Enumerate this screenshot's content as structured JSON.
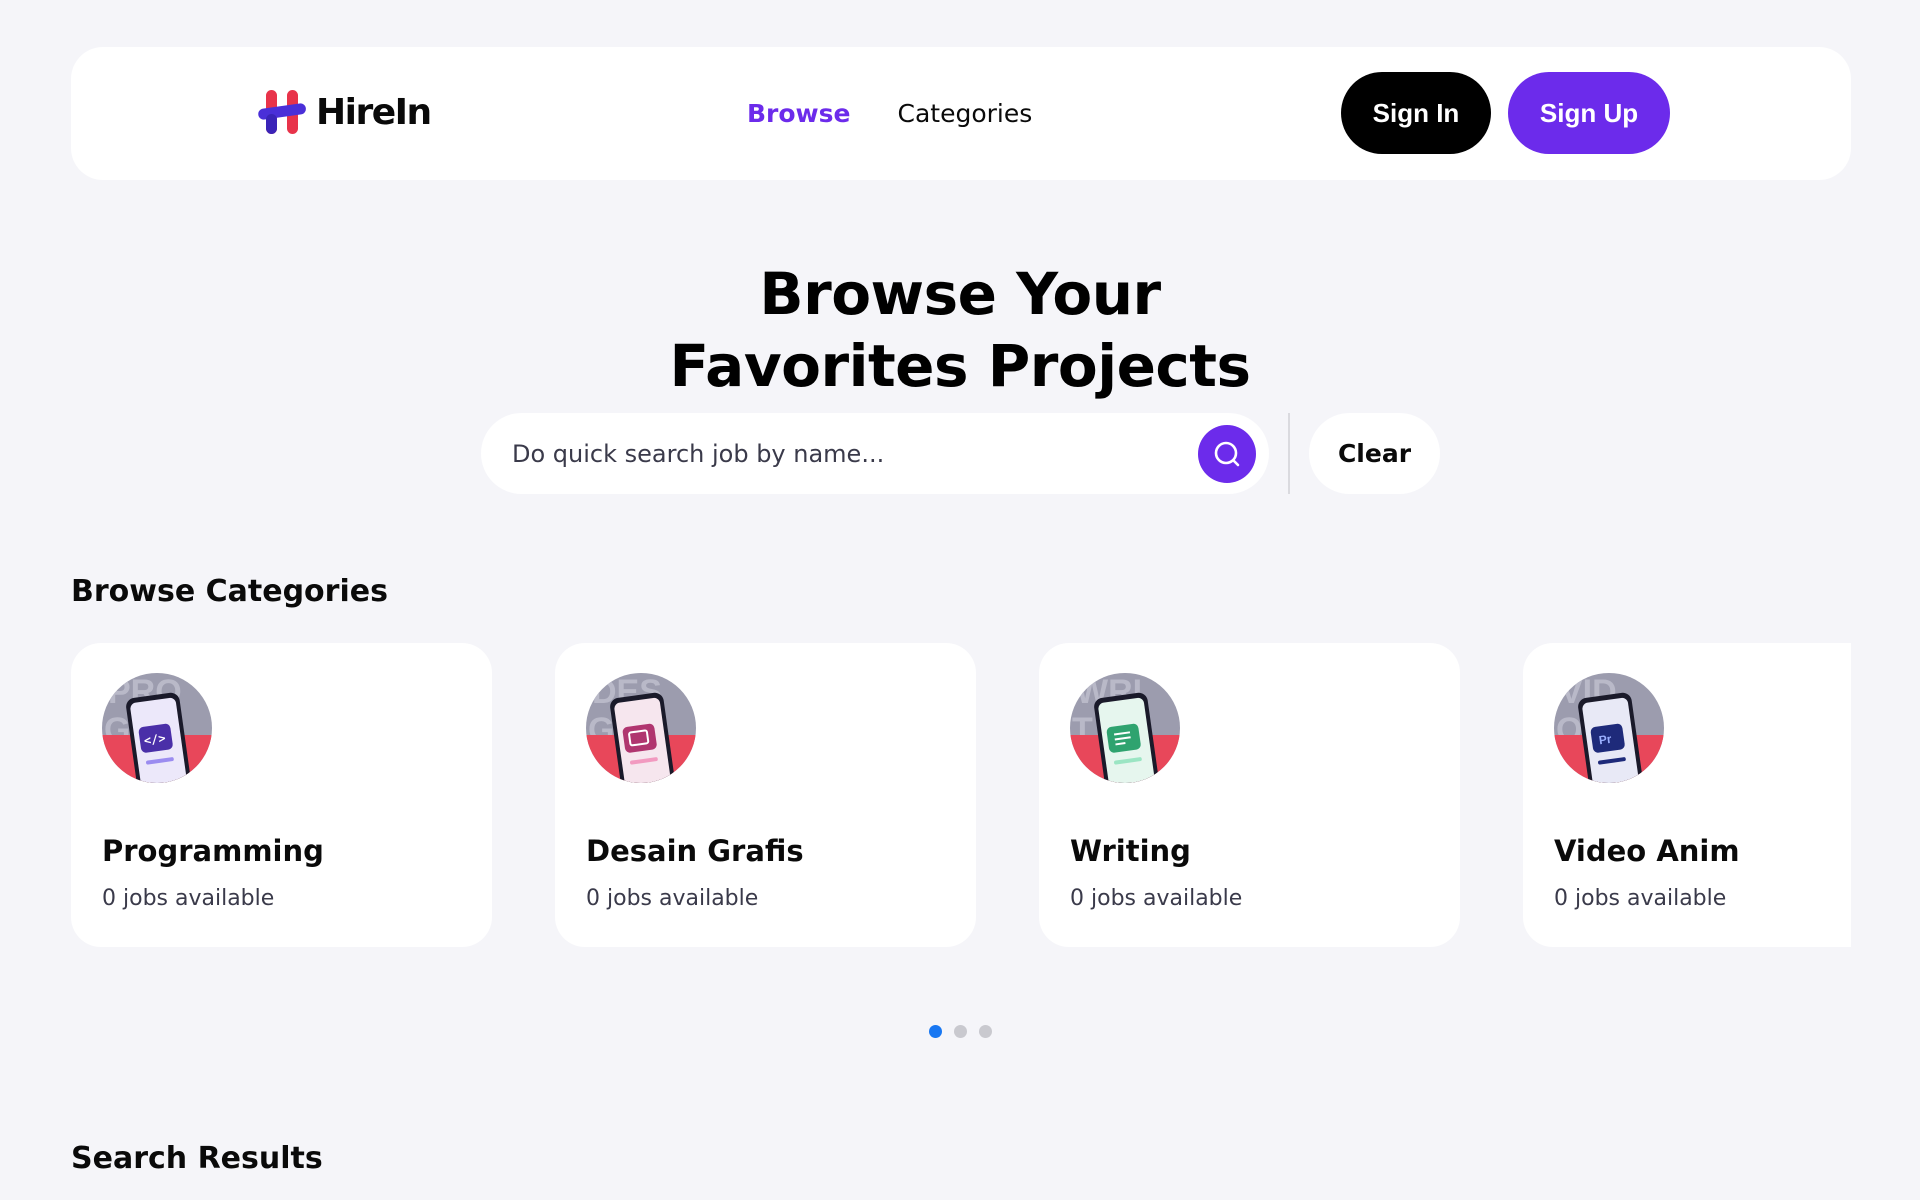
{
  "brand": {
    "name": "HireIn",
    "colors": {
      "accent": "#6C2BEB",
      "logo_red": "#E8334A",
      "logo_blue": "#4A2FD8"
    }
  },
  "nav": {
    "links": [
      {
        "label": "Browse",
        "active": true
      },
      {
        "label": "Categories",
        "active": false
      }
    ],
    "sign_in": "Sign In",
    "sign_up": "Sign Up"
  },
  "hero": {
    "title_line1": "Browse Your",
    "title_line2": "Favorites Projects"
  },
  "search": {
    "placeholder": "Do quick search job by name...",
    "value": "",
    "search_icon": "search-icon",
    "clear_label": "Clear"
  },
  "categories": {
    "title": "Browse Categories",
    "items": [
      {
        "name": "Programming",
        "count": "0 jobs available",
        "icon": "code-icon",
        "bg_text": "PRO G",
        "icon_color": "#4A2FA8",
        "bar_color": "#9B8CF0"
      },
      {
        "name": "Desain Grafis",
        "count": "0 jobs available",
        "icon": "design-icon",
        "bg_text": "DES G",
        "icon_color": "#B0356F",
        "bar_color": "#F29AC0"
      },
      {
        "name": "Writing",
        "count": "0 jobs available",
        "icon": "writing-icon",
        "bg_text": "WRI T",
        "icon_color": "#2FA36F",
        "bar_color": "#9BE5C3"
      },
      {
        "name": "Video Anim",
        "count": "0 jobs available",
        "icon": "premiere-icon",
        "bg_text": "VID O",
        "icon_color": "#1E2A7A",
        "bar_color": "#1E2A7A"
      }
    ],
    "carousel": {
      "pages": 3,
      "active_page": 1
    }
  },
  "results": {
    "title": "Search Results"
  }
}
